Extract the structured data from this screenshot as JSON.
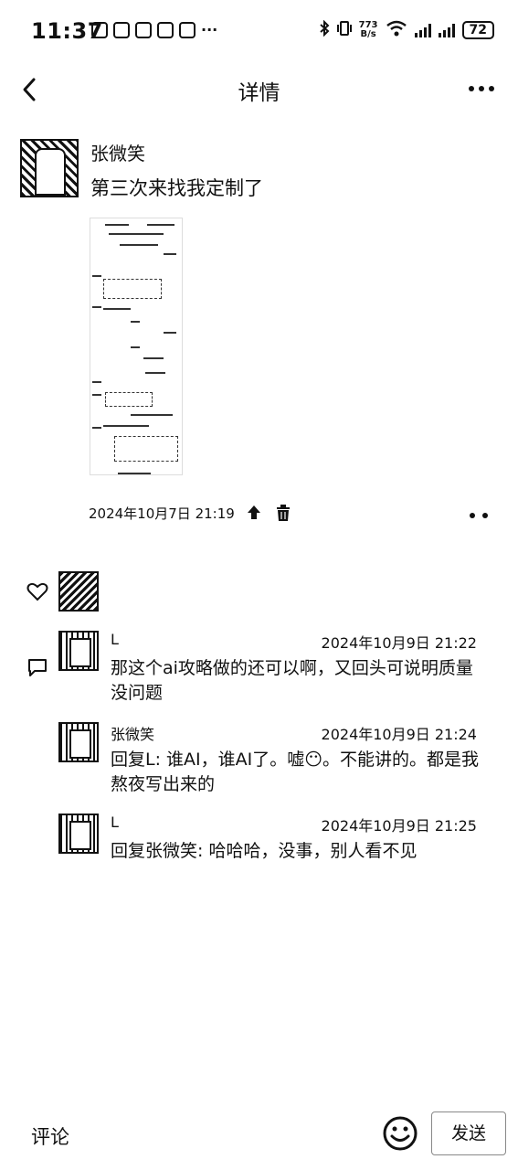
{
  "status_bar": {
    "time": "11:37",
    "network_speed_value": "773",
    "network_speed_unit": "B/s",
    "battery": "72"
  },
  "header": {
    "title": "详情"
  },
  "post": {
    "author": "张微笑",
    "text": "第三次来找我定制了",
    "timestamp": "2024年10月7日 21:19"
  },
  "comments": [
    {
      "author": "L",
      "time": "2024年10月9日 21:22",
      "text": "那这个ai攻略做的还可以啊，又回头可说明质量没问题"
    },
    {
      "author": "张微笑",
      "time": "2024年10月9日 21:24",
      "text": "回复L: 谁AI，谁AI了。嘘😶。不能讲的。都是我熬夜写出来的"
    },
    {
      "author": "L",
      "time": "2024年10月9日 21:25",
      "text": "回复张微笑: 哈哈哈，没事，别人看不见"
    }
  ],
  "bottom_bar": {
    "comment_label": "评论",
    "send_label": "发送"
  },
  "icons": {
    "back": "chevron-left-icon",
    "more": "more-dots-icon",
    "share": "upload-icon",
    "delete": "trash-icon",
    "like": "heart-icon",
    "comment": "comment-bubble-icon",
    "emoji": "smiley-icon"
  }
}
